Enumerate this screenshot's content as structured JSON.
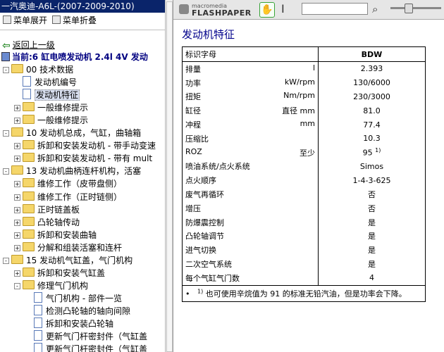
{
  "window": {
    "title": "一汽奥迪-A6L-(2007-2009-2010)"
  },
  "menu": {
    "expand": "菜单展开",
    "collapse": "菜单折叠"
  },
  "nav": {
    "back": "返回上一级",
    "current": "当前:6 缸电喷发动机  2.4l 4V 发动"
  },
  "tree": [
    {
      "label": "00 技术数据",
      "type": "folder",
      "pm": "-",
      "level": 0
    },
    {
      "label": "发动机编号",
      "type": "doc",
      "level": 1
    },
    {
      "label": "发动机特征",
      "type": "doc",
      "level": 1,
      "selected": true
    },
    {
      "label": "一般维修提示",
      "type": "folder",
      "pm": "+",
      "level": 1
    },
    {
      "label": "一般维修提示",
      "type": "folder",
      "pm": "+",
      "level": 1
    },
    {
      "label": "10 发动机总成，气缸，曲轴箱",
      "type": "folder",
      "pm": "-",
      "level": 0
    },
    {
      "label": "拆卸和安装发动机 - 带手动变速",
      "type": "folder",
      "pm": "+",
      "level": 1
    },
    {
      "label": "拆卸和安装发动机 - 带有 mult",
      "type": "folder",
      "pm": "+",
      "level": 1
    },
    {
      "label": "13 发动机曲柄连杆机构，活塞",
      "type": "folder",
      "pm": "-",
      "level": 0
    },
    {
      "label": "维修工作（皮带盘侧）",
      "type": "folder",
      "pm": "+",
      "level": 1
    },
    {
      "label": "维修工作（正时链侧）",
      "type": "folder",
      "pm": "+",
      "level": 1
    },
    {
      "label": "正时链盖板",
      "type": "folder",
      "pm": "+",
      "level": 1
    },
    {
      "label": "凸轮轴传动",
      "type": "folder",
      "pm": "+",
      "level": 1
    },
    {
      "label": "拆卸和安装曲轴",
      "type": "folder",
      "pm": "+",
      "level": 1
    },
    {
      "label": "分解和组装活塞和连杆",
      "type": "folder",
      "pm": "+",
      "level": 1
    },
    {
      "label": "15 发动机气缸盖，气门机构",
      "type": "folder",
      "pm": "-",
      "level": 0
    },
    {
      "label": "拆卸和安装气缸盖",
      "type": "folder",
      "pm": "+",
      "level": 1
    },
    {
      "label": "修理气门机构",
      "type": "folder",
      "pm": "-",
      "level": 1
    },
    {
      "label": "气门机构 - 部件一览",
      "type": "doc",
      "level": 2
    },
    {
      "label": "检测凸轮轴的轴向间隙",
      "type": "doc",
      "level": 2
    },
    {
      "label": "拆卸和安装凸轮轴",
      "type": "doc",
      "level": 2
    },
    {
      "label": "更新气门杆密封件（气缸盖",
      "type": "doc",
      "level": 2
    },
    {
      "label": "更新气门杆密封件（气缸盖",
      "type": "doc",
      "level": 2
    }
  ],
  "viewer": {
    "logo_top": "macromedia",
    "logo_main": "FLASHPAPER",
    "hand_icon": "hand-icon",
    "search_icon": "magnifier-icon"
  },
  "document": {
    "title": "发动机特征",
    "header": {
      "col1": "标识字母",
      "col2": "BDW"
    },
    "rows": [
      {
        "name": "排量",
        "unit": "l",
        "value": "2.393"
      },
      {
        "name": "功率",
        "unit": "kW/rpm",
        "value": "130/6000"
      },
      {
        "name": "扭矩",
        "unit": "Nm/rpm",
        "value": "230/3000"
      },
      {
        "name": "缸径",
        "unit": "直径  mm",
        "value": "81.0"
      },
      {
        "name": "冲程",
        "unit": "mm",
        "value": "77.4"
      },
      {
        "name": "压缩比",
        "unit": "",
        "value": "10.3"
      },
      {
        "name": "ROZ",
        "unit": "至少",
        "value": "95",
        "sup": "1)"
      },
      {
        "name": "喷油系统/点火系统",
        "unit": "",
        "value": "Simos"
      },
      {
        "name": "点火顺序",
        "unit": "",
        "value": "1-4-3-625"
      },
      {
        "name": "废气再循环",
        "unit": "",
        "value": "否"
      },
      {
        "name": "增压",
        "unit": "",
        "value": "否"
      },
      {
        "name": "防爆震控制",
        "unit": "",
        "value": "是"
      },
      {
        "name": "凸轮轴调节",
        "unit": "",
        "value": "是"
      },
      {
        "name": "进气切换",
        "unit": "",
        "value": "是"
      },
      {
        "name": "二次空气系统",
        "unit": "",
        "value": "是"
      },
      {
        "name": "每个气缸气门数",
        "unit": "",
        "value": "4"
      }
    ],
    "footnote_bullet": "•",
    "footnote_mark": "1)",
    "footnote": "也可使用辛烷值为 91 的标准无铅汽油，但是功率会下降。"
  }
}
